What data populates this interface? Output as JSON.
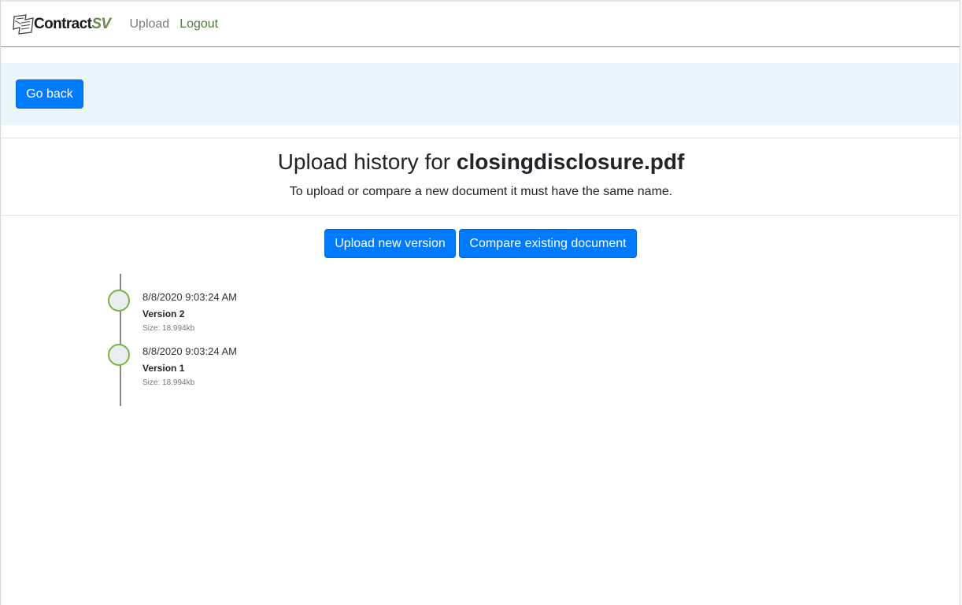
{
  "navbar": {
    "brand_main": "Contract",
    "brand_accent": "SV",
    "links": [
      {
        "label": "Upload"
      },
      {
        "label": "Logout"
      }
    ]
  },
  "backbar": {
    "back_label": "Go back"
  },
  "header": {
    "title_prefix": "Upload history for ",
    "file_name": "closingdisclosure.pdf",
    "subtitle": "To upload or compare a new document it must have the same name."
  },
  "actions": {
    "upload_label": "Upload new version",
    "compare_label": "Compare existing document"
  },
  "history": [
    {
      "date": "8/8/2020 9:03:24 AM",
      "version": "Version 2",
      "size": "Size: 18.994kb"
    },
    {
      "date": "8/8/2020 9:03:24 AM",
      "version": "Version 1",
      "size": "Size: 18.994kb"
    }
  ],
  "colors": {
    "primary": "#007bff",
    "accent_green": "#7cb342",
    "backbar_bg": "#ebf6fc"
  }
}
